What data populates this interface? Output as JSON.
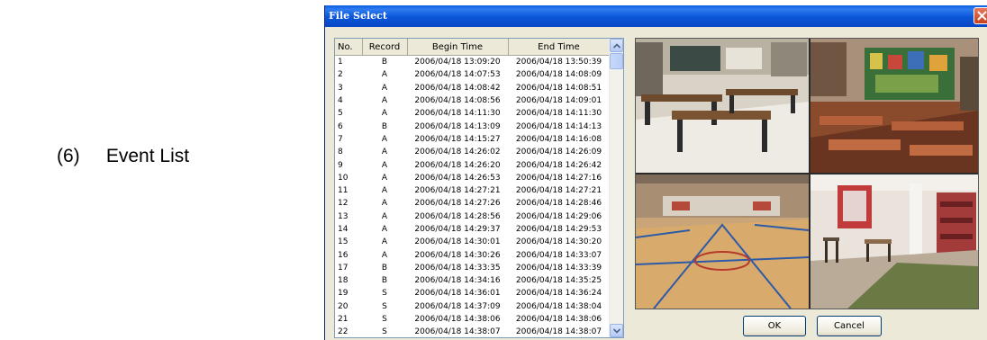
{
  "document": {
    "caption_number": "(6)",
    "caption_text": "Event List"
  },
  "dialog": {
    "title": "File Select",
    "close_icon": "close-icon",
    "ok_label": "OK",
    "cancel_label": "Cancel"
  },
  "event_table": {
    "headers": [
      "No.",
      "Record",
      "Begin Time",
      "End Time"
    ],
    "rows": [
      [
        "1",
        "B",
        "2006/04/18 13:09:20",
        "2006/04/18 13:50:39"
      ],
      [
        "2",
        "A",
        "2006/04/18 14:07:53",
        "2006/04/18 14:08:09"
      ],
      [
        "3",
        "A",
        "2006/04/18 14:08:42",
        "2006/04/18 14:08:51"
      ],
      [
        "4",
        "A",
        "2006/04/18 14:08:56",
        "2006/04/18 14:09:01"
      ],
      [
        "5",
        "A",
        "2006/04/18 14:11:30",
        "2006/04/18 14:11:30"
      ],
      [
        "6",
        "B",
        "2006/04/18 14:13:09",
        "2006/04/18 14:14:13"
      ],
      [
        "7",
        "A",
        "2006/04/18 14:15:27",
        "2006/04/18 14:16:08"
      ],
      [
        "8",
        "A",
        "2006/04/18 14:26:02",
        "2006/04/18 14:26:09"
      ],
      [
        "9",
        "A",
        "2006/04/18 14:26:20",
        "2006/04/18 14:26:42"
      ],
      [
        "10",
        "A",
        "2006/04/18 14:26:53",
        "2006/04/18 14:27:16"
      ],
      [
        "11",
        "A",
        "2006/04/18 14:27:21",
        "2006/04/18 14:27:21"
      ],
      [
        "12",
        "A",
        "2006/04/18 14:27:26",
        "2006/04/18 14:28:46"
      ],
      [
        "13",
        "A",
        "2006/04/18 14:28:56",
        "2006/04/18 14:29:06"
      ],
      [
        "14",
        "A",
        "2006/04/18 14:29:37",
        "2006/04/18 14:29:53"
      ],
      [
        "15",
        "A",
        "2006/04/18 14:30:01",
        "2006/04/18 14:30:20"
      ],
      [
        "16",
        "A",
        "2006/04/18 14:30:26",
        "2006/04/18 14:33:07"
      ],
      [
        "17",
        "B",
        "2006/04/18 14:33:35",
        "2006/04/18 14:33:39"
      ],
      [
        "18",
        "B",
        "2006/04/18 14:34:16",
        "2006/04/18 14:35:25"
      ],
      [
        "19",
        "S",
        "2006/04/18 14:36:01",
        "2006/04/18 14:36:24"
      ],
      [
        "20",
        "S",
        "2006/04/18 14:37:09",
        "2006/04/18 14:38:04"
      ],
      [
        "21",
        "S",
        "2006/04/18 14:38:06",
        "2006/04/18 14:38:06"
      ],
      [
        "22",
        "S",
        "2006/04/18 14:38:07",
        "2006/04/18 14:38:07"
      ]
    ]
  },
  "scrollbar": {
    "up_icon": "chevron-up-icon",
    "down_icon": "chevron-down-icon",
    "position": 0.0
  },
  "preview": {
    "cameras": [
      {
        "icon": "camera-view-classroom-tables"
      },
      {
        "icon": "camera-view-classroom-desks"
      },
      {
        "icon": "camera-view-gymnasium"
      },
      {
        "icon": "camera-view-playroom"
      }
    ]
  },
  "colors": {
    "titlebar": "#0a5fe0",
    "dialog_background": "#ece9d8",
    "close_button": "#d8553a"
  }
}
